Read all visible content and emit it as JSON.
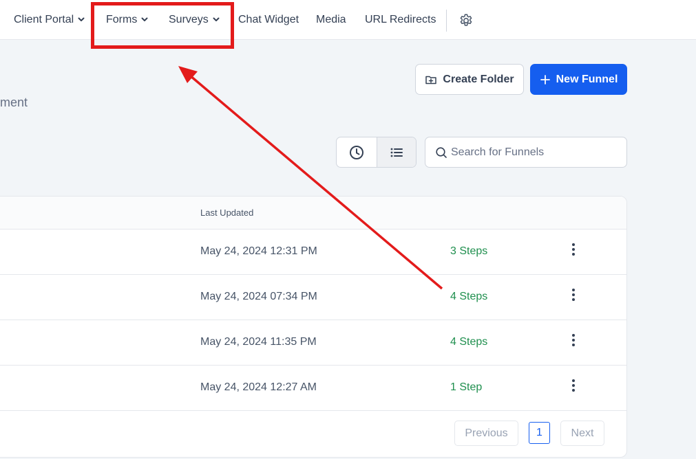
{
  "nav": {
    "items": [
      {
        "label": "Client Portal",
        "dropdown": true
      },
      {
        "label": "Forms",
        "dropdown": true
      },
      {
        "label": "Surveys",
        "dropdown": true
      },
      {
        "label": "Chat Widget",
        "dropdown": false
      },
      {
        "label": "Media",
        "dropdown": false
      },
      {
        "label": "URL Redirects",
        "dropdown": false
      }
    ],
    "settings_icon": "gear-icon"
  },
  "header": {
    "description_fragment": "ment",
    "create_folder_label": "Create Folder",
    "new_funnel_label": "New Funnel"
  },
  "toolbar": {
    "view_options": [
      "clock-icon",
      "list-icon"
    ],
    "active_view": "list",
    "search_placeholder": "Search for Funnels"
  },
  "table": {
    "columns": {
      "last_updated": "Last Updated"
    },
    "rows": [
      {
        "updated": "May 24, 2024 12:31 PM",
        "steps": "3 Steps"
      },
      {
        "updated": "May 24, 2024 07:34 PM",
        "steps": "4 Steps"
      },
      {
        "updated": "May 24, 2024 11:35 PM",
        "steps": "4 Steps"
      },
      {
        "updated": "May 24, 2024 12:27 AM",
        "steps": "1 Step"
      }
    ]
  },
  "pagination": {
    "previous_label": "Previous",
    "current_page": "1",
    "next_label": "Next"
  },
  "colors": {
    "primary": "#155eef",
    "steps_green": "#1f8f4e",
    "annotation_red": "#e31b1b"
  }
}
